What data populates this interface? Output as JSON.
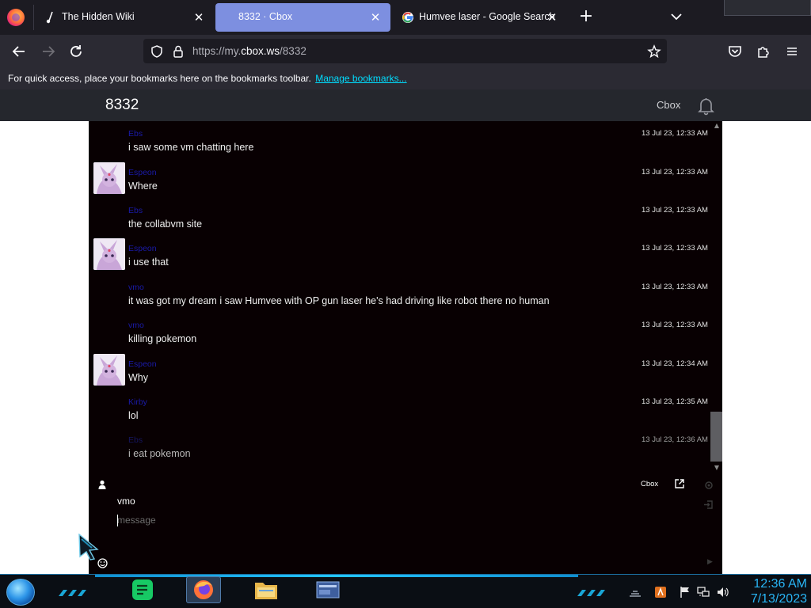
{
  "browser": {
    "tabs": [
      {
        "title": "The Hidden Wiki",
        "active": false
      },
      {
        "title": "8332 · Cbox",
        "active": true
      },
      {
        "title": "Humvee laser - Google Search",
        "active": false
      }
    ],
    "url": {
      "prefix": "https://my.",
      "domain": "cbox.ws",
      "path": "/8332"
    },
    "bookmarks_text": "For quick access, place your bookmarks here on the bookmarks toolbar.",
    "bookmarks_link": "Manage bookmarks..."
  },
  "cbox": {
    "title": "8332",
    "brand": "Cbox",
    "messages": [
      {
        "name": "Ebs",
        "text": "i saw some vm chatting here",
        "time": "13 Jul 23, 12:33 AM",
        "avatar": false
      },
      {
        "name": "Espeon",
        "text": "Where",
        "time": "13 Jul 23, 12:33 AM",
        "avatar": true
      },
      {
        "name": "Ebs",
        "text": "the collabvm site",
        "time": "13 Jul 23, 12:33 AM",
        "avatar": false
      },
      {
        "name": "Espeon",
        "text": "i use that",
        "time": "13 Jul 23, 12:33 AM",
        "avatar": true
      },
      {
        "name": "vmo",
        "text": "it was got my dream i saw Humvee with OP gun laser he's had driving like robot there no human",
        "time": "13 Jul 23, 12:33 AM",
        "avatar": false
      },
      {
        "name": "vmo",
        "text": "killing pokemon",
        "time": "13 Jul 23, 12:33 AM",
        "avatar": false
      },
      {
        "name": "Espeon",
        "text": "Why",
        "time": "13 Jul 23, 12:34 AM",
        "avatar": true
      },
      {
        "name": "Kirby",
        "text": "lol",
        "time": "13 Jul 23, 12:35 AM",
        "avatar": false
      },
      {
        "name": "Ebs",
        "text": "i eat pokemon",
        "time": "13 Jul 23, 12:36 AM",
        "avatar": false,
        "dim": true
      }
    ],
    "form": {
      "brand": "Cbox",
      "name_value": "vmo",
      "message_placeholder": "message"
    }
  },
  "taskbar": {
    "apps": [
      "notes-app",
      "firefox",
      "file-explorer",
      "window-manager"
    ],
    "clock_time": "12:36 AM",
    "clock_date": "7/13/2023"
  },
  "colors": {
    "accent_tab": "#7d8fe0",
    "chat_bg": "#080002",
    "name_color": "#1a1aa8",
    "clock_color": "#29b6f6"
  }
}
